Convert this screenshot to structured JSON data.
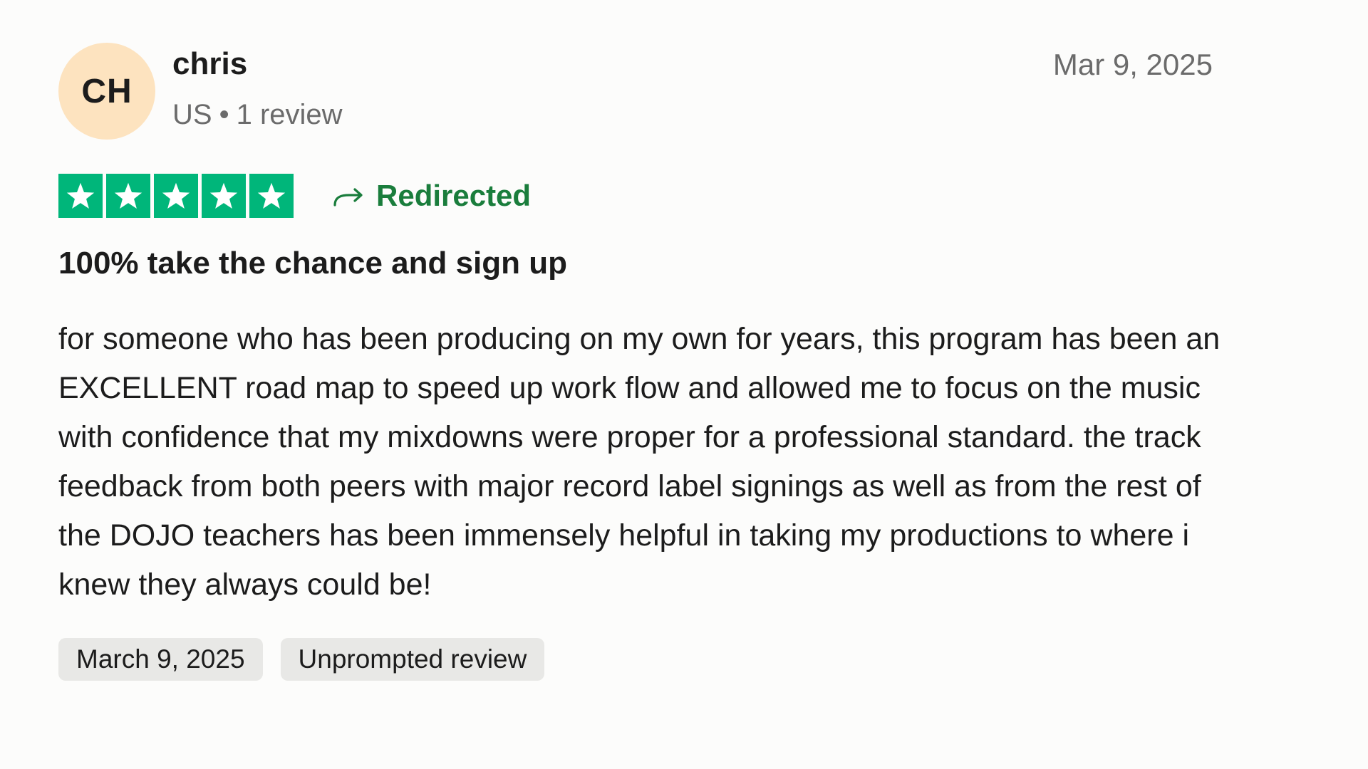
{
  "reviewer": {
    "initials": "CH",
    "name": "chris",
    "country": "US",
    "separator": "•",
    "review_count": "1 review"
  },
  "review": {
    "date": "Mar 9, 2025",
    "rating": 5,
    "rating_color": "#00b67a",
    "redirected_label": "Redirected",
    "title": "100% take the chance and sign up",
    "body": "for someone who has been producing on my own for years, this program has been an EXCELLENT road map to speed up work flow and allowed me to focus on the music with confidence that my mixdowns were proper for a professional standard. the track feedback from both peers with major record label signings as well as from the rest of the DOJO teachers has been immensely helpful in taking my productions to where i knew they always could be!"
  },
  "tags": {
    "experience_date": "March 9, 2025",
    "review_type": "Unprompted review"
  },
  "icons": {
    "star": "star-icon",
    "redirect": "redirect-arrow-icon"
  }
}
